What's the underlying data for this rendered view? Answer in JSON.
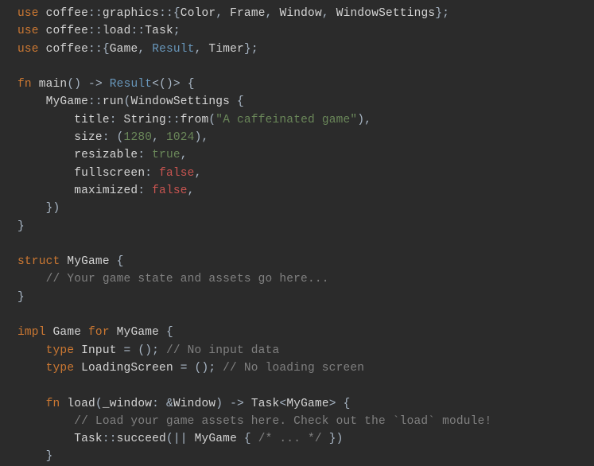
{
  "code": {
    "l1": {
      "use": "use",
      "path1": "coffee",
      "path2": "graphics",
      "i1": "Color",
      "i2": "Frame",
      "i3": "Window",
      "i4": "WindowSettings"
    },
    "l2": {
      "use": "use",
      "path1": "coffee",
      "path2": "load",
      "i1": "Task"
    },
    "l3": {
      "use": "use",
      "path1": "coffee",
      "i1": "Game",
      "i2": "Result",
      "i3": "Timer"
    },
    "l5": {
      "fn": "fn",
      "name": "main",
      "arrow": "->",
      "ret": "Result"
    },
    "l6": {
      "ty": "MyGame",
      "method": "run",
      "st": "WindowSettings"
    },
    "l7": {
      "field": "title",
      "sty": "String",
      "sfn": "from",
      "str": "\"A caffeinated game\""
    },
    "l8": {
      "field": "size",
      "n1": "1280",
      "n2": "1024"
    },
    "l9": {
      "field": "resizable",
      "val": "true"
    },
    "l10": {
      "field": "fullscreen",
      "val": "false"
    },
    "l11": {
      "field": "maximized",
      "val": "false"
    },
    "l15": {
      "kw": "struct",
      "name": "MyGame"
    },
    "l16": {
      "cmt": "// Your game state and assets go here..."
    },
    "l19": {
      "kw1": "impl",
      "tr": "Game",
      "kw2": "for",
      "ty": "MyGame"
    },
    "l20": {
      "kw": "type",
      "name": "Input",
      "cmt": "// No input data"
    },
    "l21": {
      "kw": "type",
      "name": "LoadingScreen",
      "cmt": "// No loading screen"
    },
    "l23": {
      "fn": "fn",
      "name": "load",
      "param": "_window",
      "pty": "Window",
      "arrow": "->",
      "rty": "Task",
      "gty": "MyGame"
    },
    "l24": {
      "cmt": "// Load your game assets here. Check out the `load` module!"
    },
    "l25": {
      "ty": "Task",
      "method": "succeed",
      "inner": "MyGame",
      "cmt": "/* ... */"
    }
  }
}
